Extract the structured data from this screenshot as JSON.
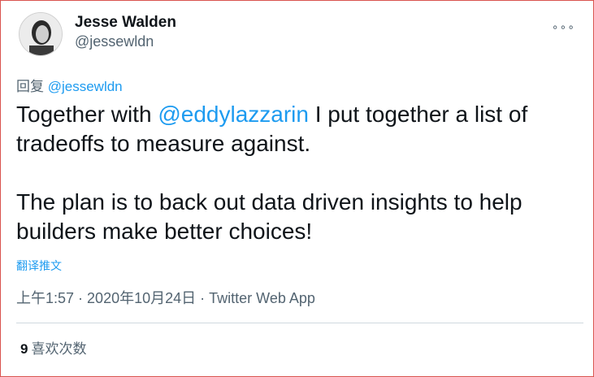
{
  "author": {
    "name": "Jesse Walden",
    "handle": "@jessewldn"
  },
  "more_icon": "more-dots-icon",
  "reply": {
    "prefix": "回复",
    "mention": "@jessewldn"
  },
  "tweet": {
    "line1_pre": "Together with ",
    "line1_mention": "@eddylazzarin",
    "line1_post": " I put together a list of tradeoffs to measure against.",
    "paragraph2": "The plan is to back out data driven insights to help builders make better choices!"
  },
  "translate_label": "翻译推文",
  "meta": {
    "time": "上午1:57",
    "sep1": " · ",
    "date": "2020年10月24日",
    "sep2": " · ",
    "source": "Twitter Web App"
  },
  "likes": {
    "count": "9",
    "label": "喜欢次数"
  },
  "colors": {
    "link": "#1d9bf0",
    "secondary": "#536471",
    "text": "#0f1419",
    "border": "#d9534f"
  }
}
